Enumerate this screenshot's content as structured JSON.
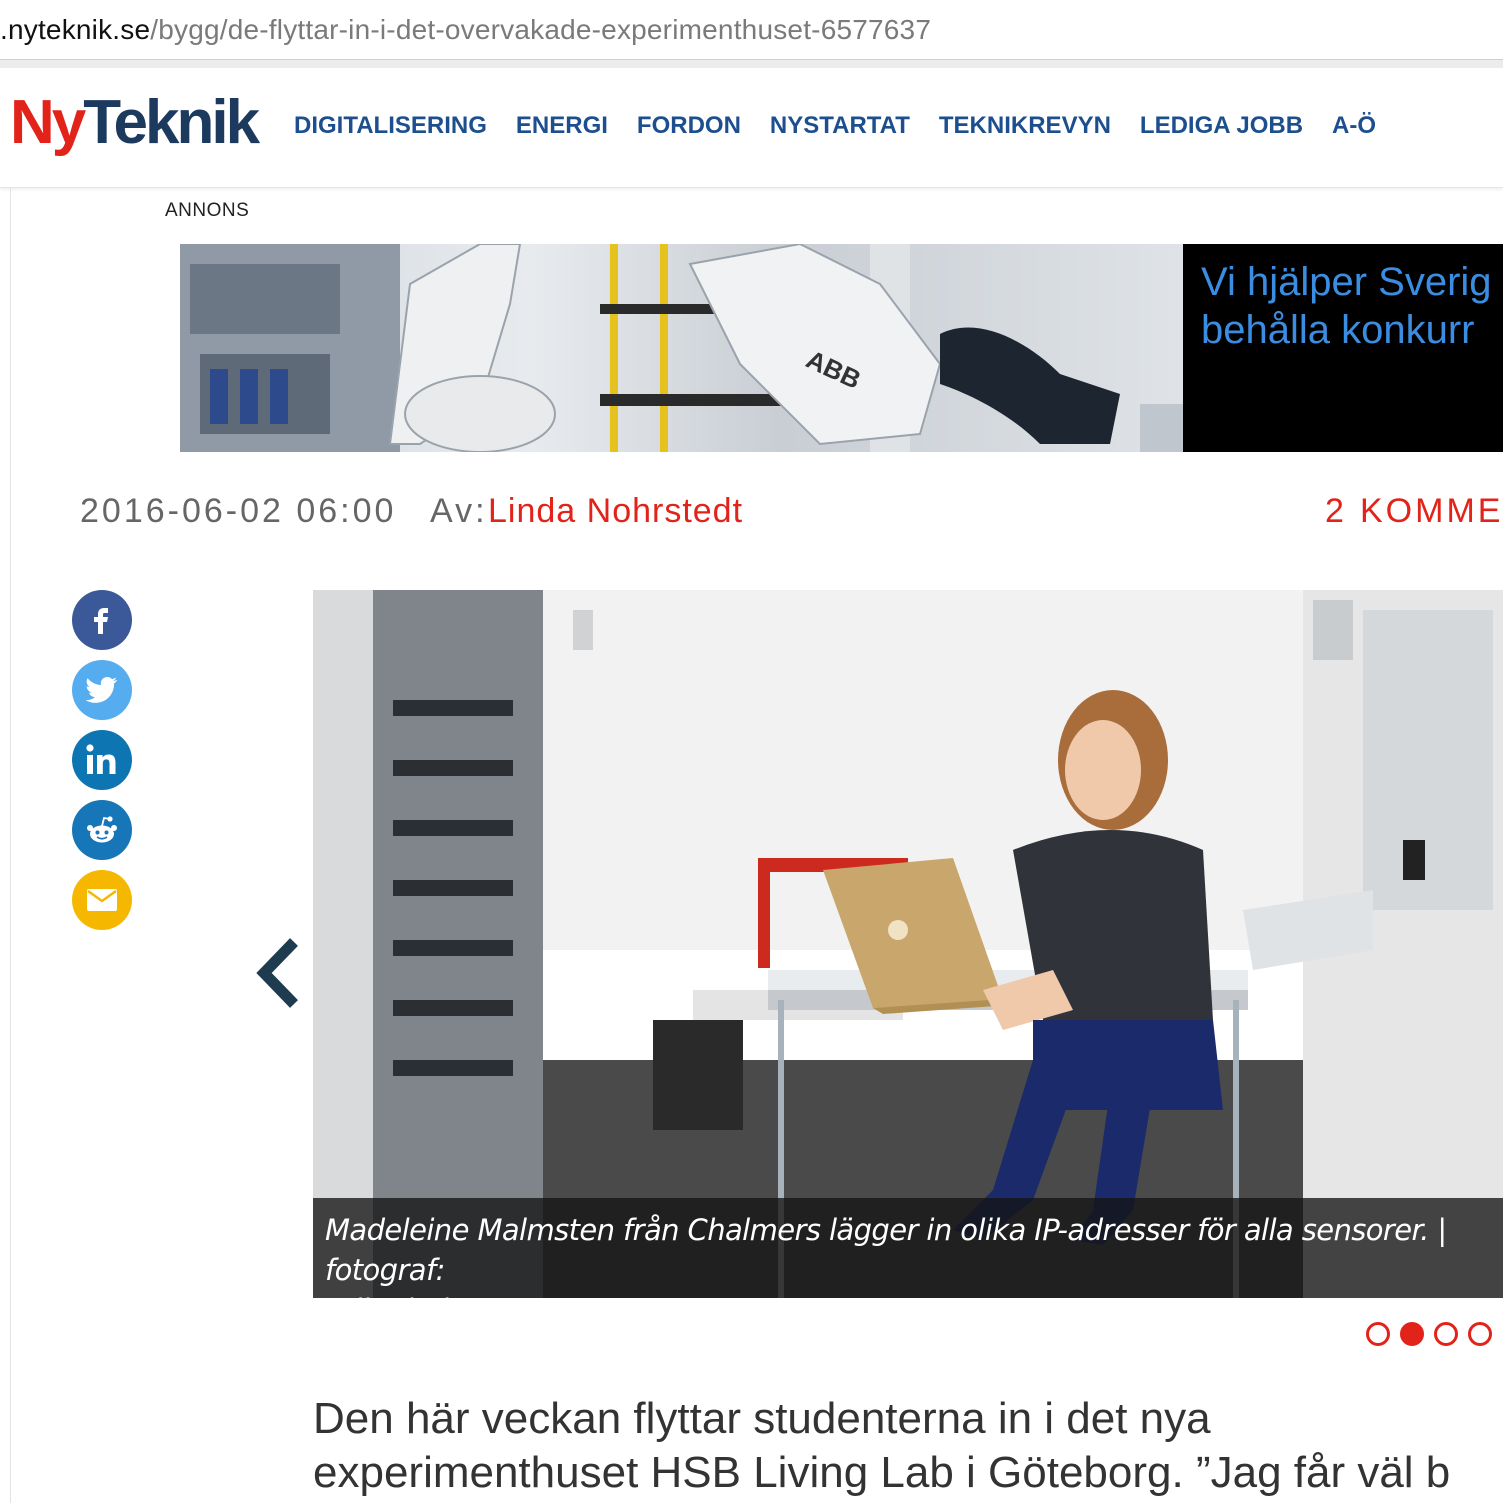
{
  "browser": {
    "url_host": ".nyteknik.se",
    "url_path": "/bygg/de-flyttar-in-i-det-overvakade-experimenthuset-6577637"
  },
  "site": {
    "logo_ny": "Ny",
    "logo_teknik": "Teknik",
    "nav": [
      "DIGITALISERING",
      "ENERGI",
      "FORDON",
      "NYSTARTAT",
      "TEKNIKREVYN",
      "LEDIGA JOBB",
      "A-Ö"
    ]
  },
  "ad": {
    "label": "ANNONS",
    "line1": "Vi hjälper Sverig",
    "line2": "behålla konkurr",
    "robot_brand": "ABB"
  },
  "article": {
    "date": "2016-06-02 06:00",
    "by_label": "Av:",
    "author": "Linda Nohrstedt",
    "comment_count": "2",
    "comments_label": "KOMMENTA",
    "caption_line1": "Madeleine Malmsten från Chalmers lägger in olika IP-adresser för alla sensorer. | fotograf:",
    "caption_line2": "Erik Abel",
    "lead_line1": "Den här veckan flyttar studenterna in i det nya",
    "lead_line2": "experimenthuset HSB Living Lab i Göteborg. ”Jag får väl b",
    "gallery_active_index": 2,
    "gallery_total": 4
  },
  "share": [
    "facebook-icon",
    "twitter-icon",
    "linkedin-icon",
    "reddit-icon",
    "mail-icon"
  ],
  "colors": {
    "brand_red": "#e2231a",
    "brand_navy": "#1c3a5e",
    "nav_blue": "#1d4f8f",
    "facebook": "#3b5998",
    "twitter": "#55acee",
    "linkedin": "#0e75b3",
    "reddit": "#1776b8",
    "mail": "#f5b700"
  }
}
